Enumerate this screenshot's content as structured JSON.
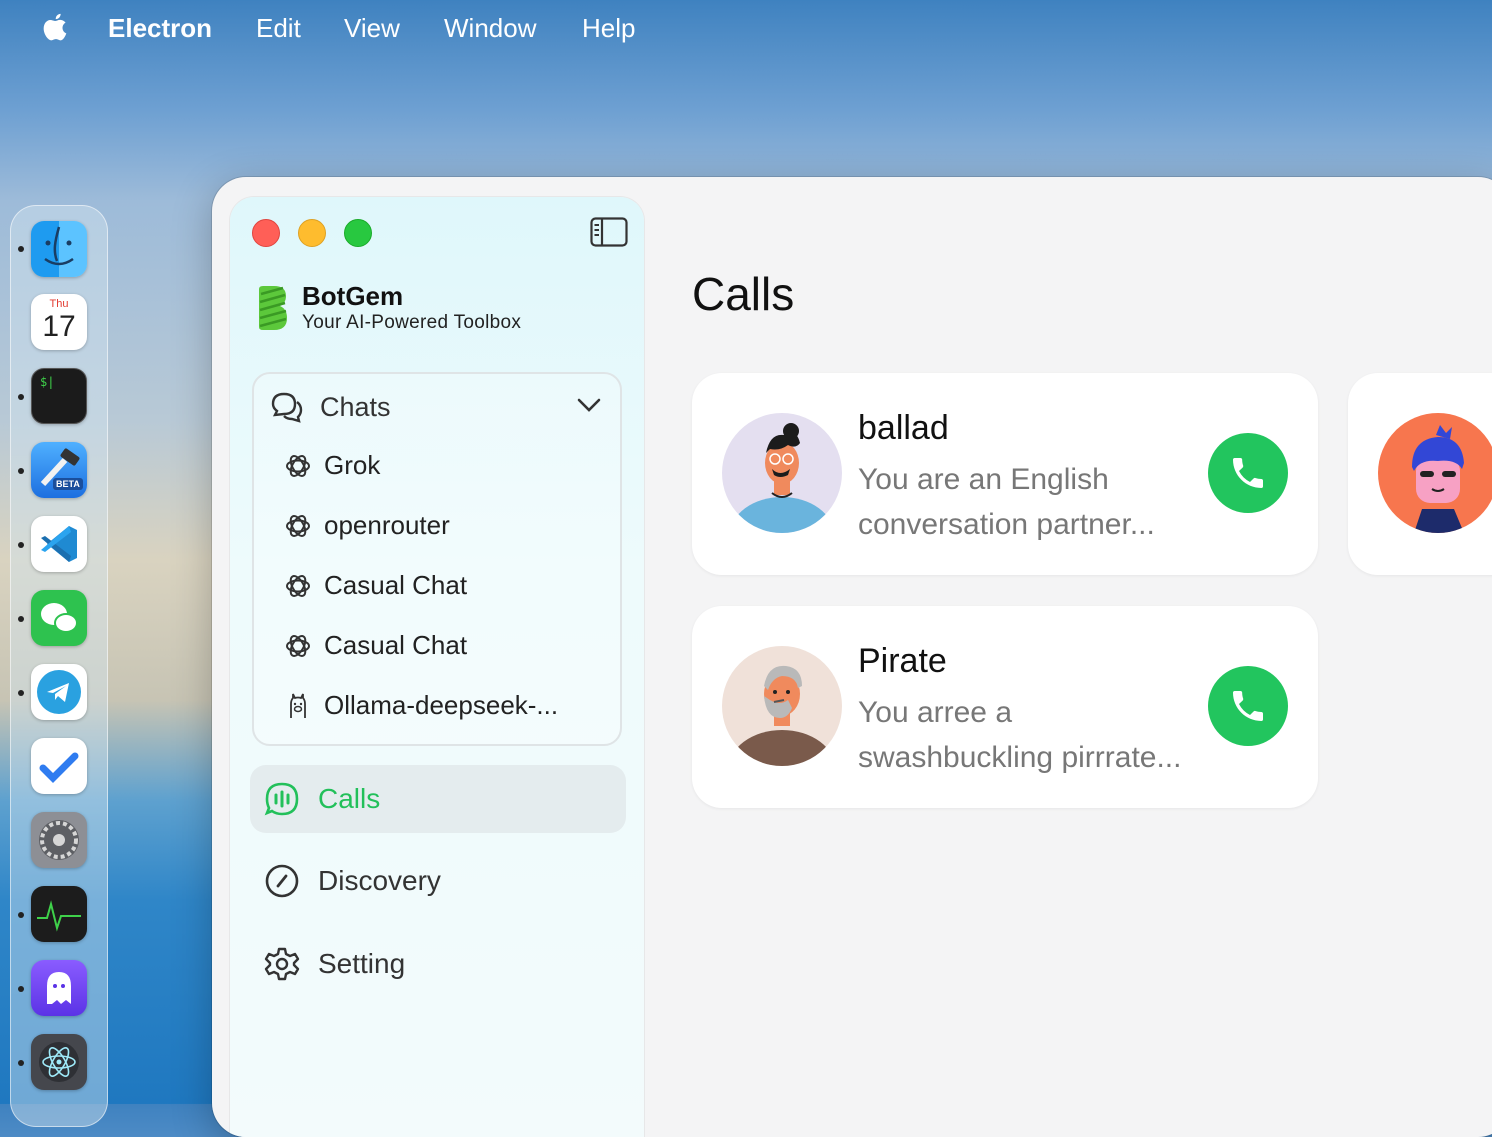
{
  "menubar": {
    "app_name": "Electron",
    "items": [
      "Edit",
      "View",
      "Window",
      "Help"
    ]
  },
  "dock": {
    "calendar_weekday": "Thu",
    "calendar_day": "17",
    "terminal_prompt": "$|",
    "xcode_badge": "BETA",
    "apps": [
      "finder-icon",
      "calendar-icon",
      "terminal-icon",
      "xcode-icon",
      "vscode-icon",
      "wechat-icon",
      "telegram-icon",
      "tasks-icon",
      "system-settings-icon",
      "activity-monitor-icon",
      "ghost-app-icon",
      "electron-icon"
    ]
  },
  "sidebar": {
    "brand_name": "BotGem",
    "brand_subtitle": "Your AI-Powered Toolbox",
    "chats": {
      "label": "Chats",
      "items": [
        {
          "label": "Grok",
          "icon": "openai-icon"
        },
        {
          "label": "openrouter",
          "icon": "openai-icon"
        },
        {
          "label": "Casual Chat",
          "icon": "openai-icon"
        },
        {
          "label": "Casual Chat",
          "icon": "openai-icon"
        },
        {
          "label": "Ollama-deepseek-...",
          "icon": "ollama-icon"
        }
      ]
    },
    "nav": [
      {
        "label": "Calls",
        "icon": "calls-icon",
        "active": true
      },
      {
        "label": "Discovery",
        "icon": "compass-icon",
        "active": false
      },
      {
        "label": "Setting",
        "icon": "gear-icon",
        "active": false
      }
    ]
  },
  "main": {
    "title": "Calls",
    "cards": [
      {
        "name": "ballad",
        "description": "You are an English conversation partner..."
      },
      {
        "name": "Pirate",
        "description": "You arree a swashbuckling pirrrate..."
      }
    ]
  },
  "colors": {
    "accent_green": "#22c55e",
    "sidebar_bg": "#e6f8fb",
    "main_bg": "#f4f4f5"
  }
}
